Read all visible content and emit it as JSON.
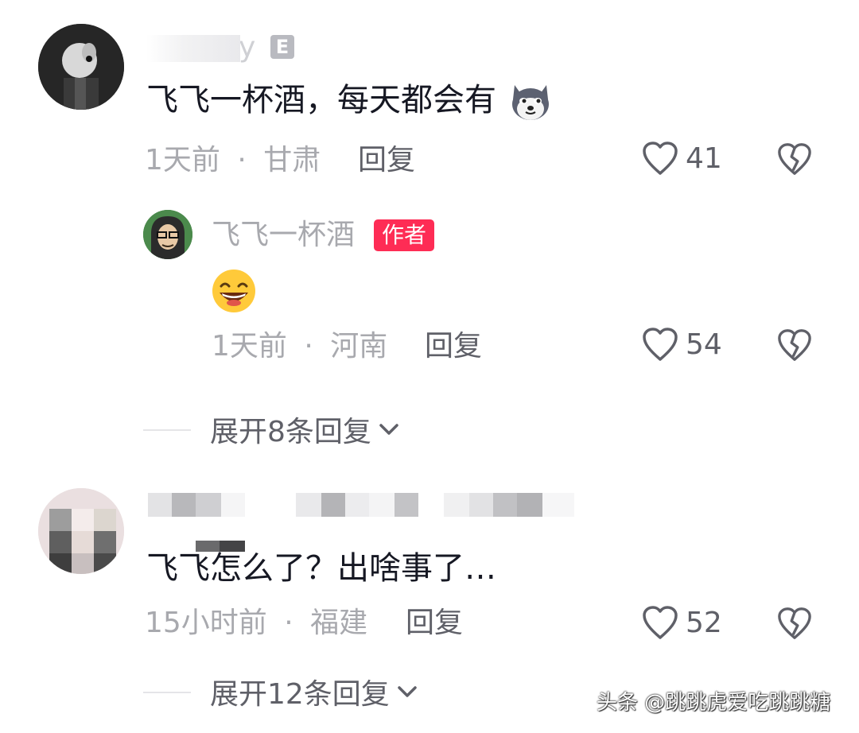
{
  "comments": [
    {
      "username": "y",
      "badge": "E",
      "text": "飞飞一杯酒，每天都会有",
      "time": "1天前",
      "location": "甘肃",
      "reply_label": "回复",
      "likes": "41",
      "replies": [
        {
          "username": "飞飞一杯酒",
          "badge": "作者",
          "time": "1天前",
          "location": "河南",
          "reply_label": "回复",
          "likes": "54"
        }
      ],
      "expand_label": "展开8条回复"
    },
    {
      "text": "飞飞怎么了？出啥事了…",
      "time": "15小时前",
      "location": "福建",
      "reply_label": "回复",
      "likes": "52",
      "expand_label": "展开12条回复"
    }
  ],
  "meta_separator": "·",
  "watermark": "头条 @跳跳虎爱吃跳跳糖",
  "colors": {
    "author_badge": "#fe2c55",
    "meta_text": "#a8a9ae",
    "icon": "#5f6068"
  },
  "icons": [
    "heart-outline-icon",
    "broken-heart-icon",
    "chevron-down-icon",
    "husky-emoji",
    "grinning-emoji"
  ]
}
